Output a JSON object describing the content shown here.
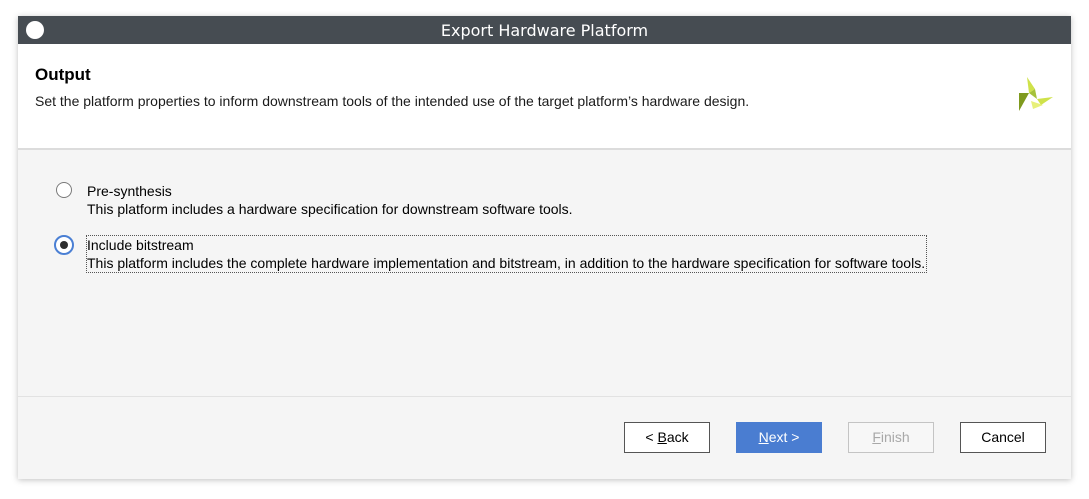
{
  "window": {
    "title": "Export Hardware Platform"
  },
  "header": {
    "title": "Output",
    "description": "Set the platform properties to inform downstream tools of the intended use of the target platform’s hardware design."
  },
  "options": [
    {
      "label": "Pre-synthesis",
      "description": "This platform includes a hardware specification for downstream software tools.",
      "selected": false
    },
    {
      "label": "Include bitstream",
      "description": "This platform includes the complete hardware implementation and bitstream, in addition to the hardware specification for software tools.",
      "selected": true
    }
  ],
  "buttons": {
    "back": {
      "prefix": "< ",
      "mnemonic": "B",
      "rest": "ack"
    },
    "next": {
      "mnemonic": "N",
      "rest": "ext >"
    },
    "finish": {
      "mnemonic": "F",
      "rest": "inish",
      "enabled": false
    },
    "cancel": {
      "label": "Cancel"
    }
  },
  "colors": {
    "titlebar": "#464c52",
    "primary": "#4a7dd1",
    "logo_dark": "#7f9a1e",
    "logo_light": "#cfe24a"
  }
}
